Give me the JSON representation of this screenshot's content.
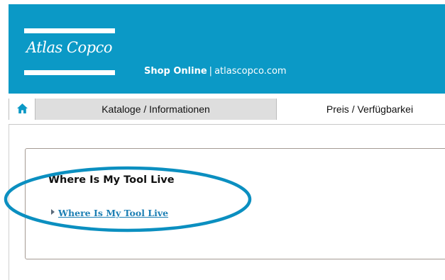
{
  "header": {
    "logo_text": "Atlas Copco",
    "shop_label": "Shop Online",
    "separator": "|",
    "site": "atlascopco.com",
    "background_color": "#0b99c6"
  },
  "tabs": [
    {
      "icon": "home-icon"
    },
    {
      "label": "Kataloge / Informationen",
      "active": true
    },
    {
      "label": "Preis / Verfügbarkei",
      "active": false
    }
  ],
  "panel": {
    "title": "Where Is My Tool Live",
    "link_label": "Where Is My Tool Live",
    "link_icon": "arrow-right-icon"
  },
  "colors": {
    "accent": "#0b99c6",
    "link": "#1d7fb4",
    "highlight": "#0b8fc0",
    "active_tab": "#dedede"
  }
}
